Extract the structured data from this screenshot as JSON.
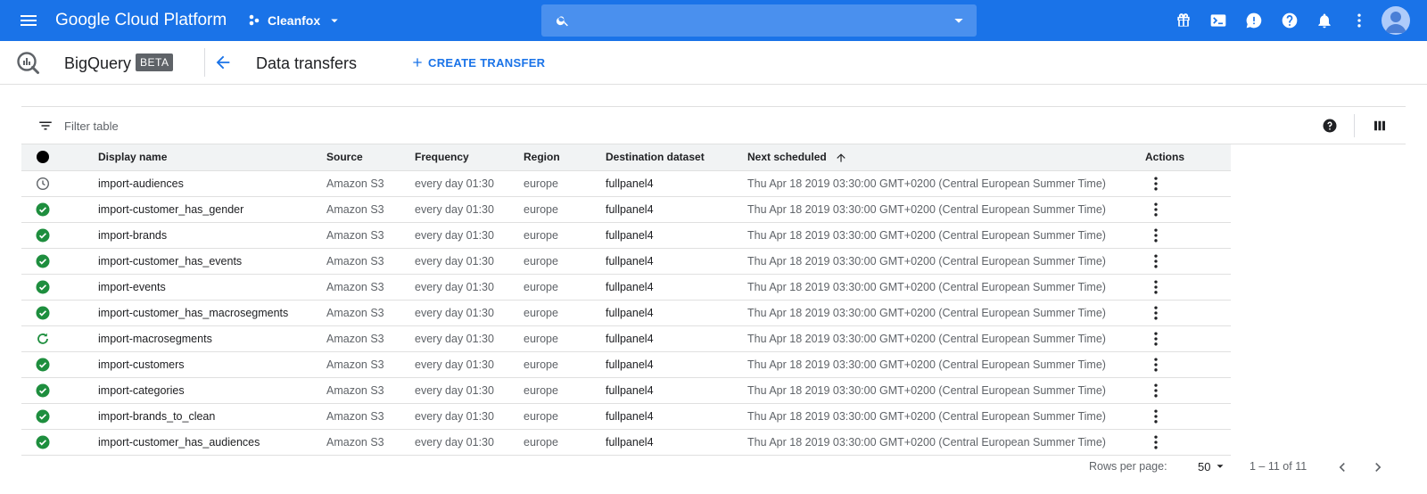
{
  "topbar": {
    "brand": "Google Cloud Platform",
    "project": "Cleanfox",
    "search_value": "",
    "icons": [
      "gift-icon",
      "cloud-shell-icon",
      "feedback-icon",
      "help-icon",
      "notifications-icon",
      "more-vert-icon"
    ],
    "color": "#1a73e8"
  },
  "subbar": {
    "product": "BigQuery",
    "badge": "BETA",
    "page_title": "Data transfers",
    "create_label": "CREATE TRANSFER"
  },
  "filter": {
    "placeholder": "Filter table"
  },
  "table": {
    "headers": {
      "display_name": "Display name",
      "source": "Source",
      "frequency": "Frequency",
      "region": "Region",
      "destination": "Destination dataset",
      "next_scheduled": "Next scheduled",
      "actions": "Actions"
    },
    "rows": [
      {
        "status": "pending",
        "name": "import-audiences",
        "source": "Amazon S3",
        "frequency": "every day 01:30",
        "region": "europe",
        "destination": "fullpanel4",
        "next": "Thu Apr 18 2019 03:30:00 GMT+0200 (Central European Summer Time)"
      },
      {
        "status": "success",
        "name": "import-customer_has_gender",
        "source": "Amazon S3",
        "frequency": "every day 01:30",
        "region": "europe",
        "destination": "fullpanel4",
        "next": "Thu Apr 18 2019 03:30:00 GMT+0200 (Central European Summer Time)"
      },
      {
        "status": "success",
        "name": "import-brands",
        "source": "Amazon S3",
        "frequency": "every day 01:30",
        "region": "europe",
        "destination": "fullpanel4",
        "next": "Thu Apr 18 2019 03:30:00 GMT+0200 (Central European Summer Time)"
      },
      {
        "status": "success",
        "name": "import-customer_has_events",
        "source": "Amazon S3",
        "frequency": "every day 01:30",
        "region": "europe",
        "destination": "fullpanel4",
        "next": "Thu Apr 18 2019 03:30:00 GMT+0200 (Central European Summer Time)"
      },
      {
        "status": "success",
        "name": "import-events",
        "source": "Amazon S3",
        "frequency": "every day 01:30",
        "region": "europe",
        "destination": "fullpanel4",
        "next": "Thu Apr 18 2019 03:30:00 GMT+0200 (Central European Summer Time)"
      },
      {
        "status": "success",
        "name": "import-customer_has_macrosegments",
        "source": "Amazon S3",
        "frequency": "every day 01:30",
        "region": "europe",
        "destination": "fullpanel4",
        "next": "Thu Apr 18 2019 03:30:00 GMT+0200 (Central European Summer Time)"
      },
      {
        "status": "running",
        "name": "import-macrosegments",
        "source": "Amazon S3",
        "frequency": "every day 01:30",
        "region": "europe",
        "destination": "fullpanel4",
        "next": "Thu Apr 18 2019 03:30:00 GMT+0200 (Central European Summer Time)"
      },
      {
        "status": "success",
        "name": "import-customers",
        "source": "Amazon S3",
        "frequency": "every day 01:30",
        "region": "europe",
        "destination": "fullpanel4",
        "next": "Thu Apr 18 2019 03:30:00 GMT+0200 (Central European Summer Time)"
      },
      {
        "status": "success",
        "name": "import-categories",
        "source": "Amazon S3",
        "frequency": "every day 01:30",
        "region": "europe",
        "destination": "fullpanel4",
        "next": "Thu Apr 18 2019 03:30:00 GMT+0200 (Central European Summer Time)"
      },
      {
        "status": "success",
        "name": "import-brands_to_clean",
        "source": "Amazon S3",
        "frequency": "every day 01:30",
        "region": "europe",
        "destination": "fullpanel4",
        "next": "Thu Apr 18 2019 03:30:00 GMT+0200 (Central European Summer Time)"
      },
      {
        "status": "success",
        "name": "import-customer_has_audiences",
        "source": "Amazon S3",
        "frequency": "every day 01:30",
        "region": "europe",
        "destination": "fullpanel4",
        "next": "Thu Apr 18 2019 03:30:00 GMT+0200 (Central European Summer Time)"
      }
    ],
    "status_colors": {
      "success": "#1e8e3e",
      "running": "#1e8e3e",
      "pending": "#5f6368"
    }
  },
  "pagination": {
    "rows_per_page_label": "Rows per page:",
    "rows_per_page": "50",
    "range": "1 – 11 of 11"
  }
}
